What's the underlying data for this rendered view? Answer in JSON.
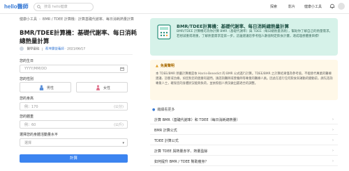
{
  "header": {
    "logo": "hello醫師",
    "search_placeholder": "搜尋 hello健康",
    "nav": [
      "探索",
      "影片",
      "健康小工具"
    ]
  },
  "breadcrumb": [
    "健康小工具",
    "BMR / TDEE 計算機：計算基礎代謝率、每日消耗熱量計算"
  ],
  "article": {
    "title": "BMR/TDEE計算機：基礎代謝率、每日消耗總熱量計算",
    "author_prefix": "醫學審稿",
    "author": "蔡坤寶營養師",
    "date": "2021/06/17"
  },
  "form": {
    "birthday_label": "您的生日",
    "birthday_placeholder": "YYYY/MM/DD",
    "gender_label": "您的性別",
    "gender_male": "男性",
    "gender_female": "女性",
    "height_label": "您的身高",
    "height_placeholder": "例：170",
    "height_unit": "(公分)",
    "weight_label": "您的體重",
    "weight_placeholder": "例：60",
    "weight_unit": "(公斤)",
    "activity_label": "選擇您的身體活動量水平",
    "activity_value": "選擇",
    "submit": "計算"
  },
  "banner": {
    "title": "BMR/TDEE計算機：基礎代謝率、每日消耗總熱量計算",
    "desc": "BMR/TDEE 計算機可為你計算 BMR（基礎代謝率）與 TDEE（每日總熱量消耗），幫助你了解自己的熱量需求。若想減重或增重，了解熱量需求是第一步。這邊建議您參考個人數值制定飲食計畫，達成理想體重目標！"
  },
  "notice": {
    "title": "免責聲明",
    "body": "本 TDEE/BMR 熱量計算機是依 Harris-Benedict 的 BMR 公式進行計算。TDEE/BMR 之計算結果僅為參考值，不能替代專業的醫療建議、診斷或治療。如您對您的健康有疑問，請諮詢醫師或營養師等專業的醫療人員。因此在進行任何飲食與運動的變動前，請先諮詢專業人士，確保您的身體狀況能夠負荷，並依照個人情況做出最適合的調整。"
  },
  "more": {
    "heading": "繼續看更多",
    "links": [
      "計算 BMR（基礎代謝率）和 TDEE（每日消耗總熱量）",
      "BMR 計算公式",
      "TDEE 計算公式",
      "計算 TDEE 與熱量赤字、熱量盈餘",
      "如何提升 BMR / TDEE 幫助瘦身？"
    ]
  },
  "colors": {
    "primary": "#3c84f0",
    "banner_bg": "#d6f2e9",
    "notice_bg": "#fff8e8"
  }
}
